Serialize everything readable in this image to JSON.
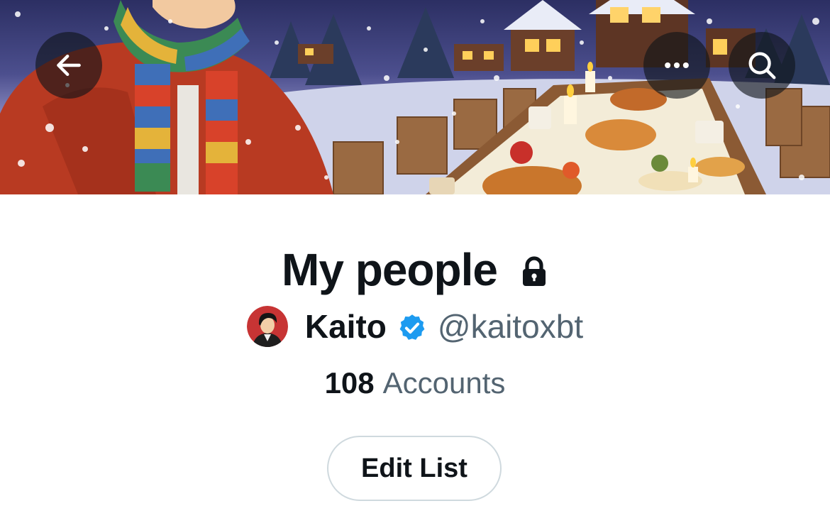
{
  "banner": {
    "back_icon": "arrow-left-icon",
    "more_icon": "more-horizontal-icon",
    "search_icon": "search-icon"
  },
  "list": {
    "title": "My people",
    "privacy_icon": "lock-icon"
  },
  "owner": {
    "name": "Kaito",
    "handle": "@kaitoxbt",
    "verified_icon": "verified-badge-icon"
  },
  "stats": {
    "count": "108",
    "label": "Accounts"
  },
  "actions": {
    "edit_label": "Edit List"
  },
  "colors": {
    "text_primary": "#0f1419",
    "text_secondary": "#536471",
    "verified_blue": "#1d9bf0",
    "button_border": "#cfd9de"
  }
}
